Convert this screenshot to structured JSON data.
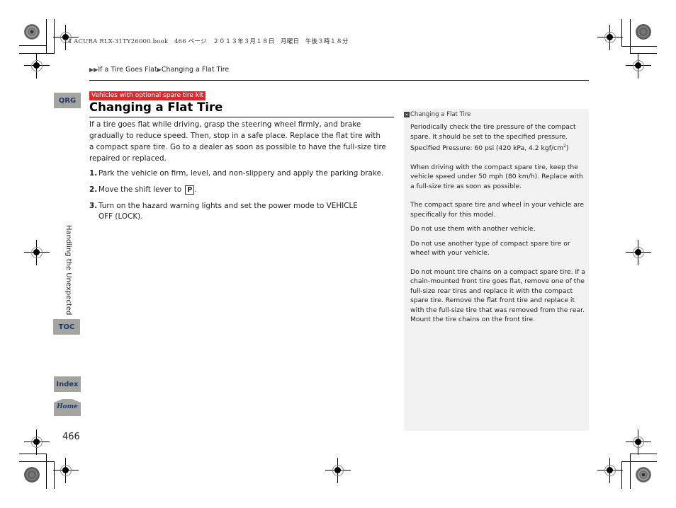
{
  "print_header": "14 ACURA RLX-31TY26000.book　466 ページ　２０１３年３月１８日　月曜日　午後３時１８分",
  "breadcrumb": {
    "arrows": "▶▶",
    "section": "If a Tire Goes Flat",
    "sep": "▶",
    "page": "Changing a Flat Tire"
  },
  "side_nav": {
    "qrg": "QRG",
    "chapter_label": "Handling the Unexpected",
    "toc": "TOC",
    "index": "Index",
    "home": "Home"
  },
  "page_number": "466",
  "main": {
    "tag": "Vehicles with optional spare tire kit",
    "title": "Changing a Flat Tire",
    "intro": "If a tire goes flat while driving, grasp the steering wheel firmly, and brake gradually to reduce speed. Then, stop in a safe place. Replace the flat tire with a compact spare tire. Go to a dealer as soon as possible to have the full-size tire repaired or replaced.",
    "steps": [
      {
        "num": "1.",
        "text": "Park the vehicle on firm, level, and non-slippery and apply the parking brake."
      },
      {
        "num": "2.",
        "text": "Move the shift lever to",
        "badge": "P",
        "suffix": "."
      },
      {
        "num": "3.",
        "text": "Turn on the hazard warning lights and set the power mode to VEHICLE OFF (LOCK)."
      }
    ]
  },
  "note": {
    "ref_icon": "»",
    "heading": "Changing a Flat Tire",
    "p1": "Periodically check the tire pressure of the compact spare. It should be set to the specified pressure.",
    "p1b": "Specified Pressure: 60 psi (420 kPa, 4.2 kgf/cm",
    "p1b_sup": "2",
    "p1b_end": ")",
    "p2": "When driving with the compact spare tire, keep the vehicle speed under 50 mph (80 km/h). Replace with a full-size tire as soon as possible.",
    "p3": "The compact spare tire and wheel in your vehicle are specifically for this model.",
    "p4": "Do not use them with another vehicle.",
    "p5": "Do not use another type of compact spare tire or wheel with your vehicle.",
    "p6": "Do not mount tire chains on a compact spare tire. If a chain-mounted front tire goes flat, remove one of the full-size rear tires and replace it with the compact spare tire. Remove the flat front tire and replace it with the full-size tire that was removed from the rear. Mount the tire chains on the front tire."
  }
}
